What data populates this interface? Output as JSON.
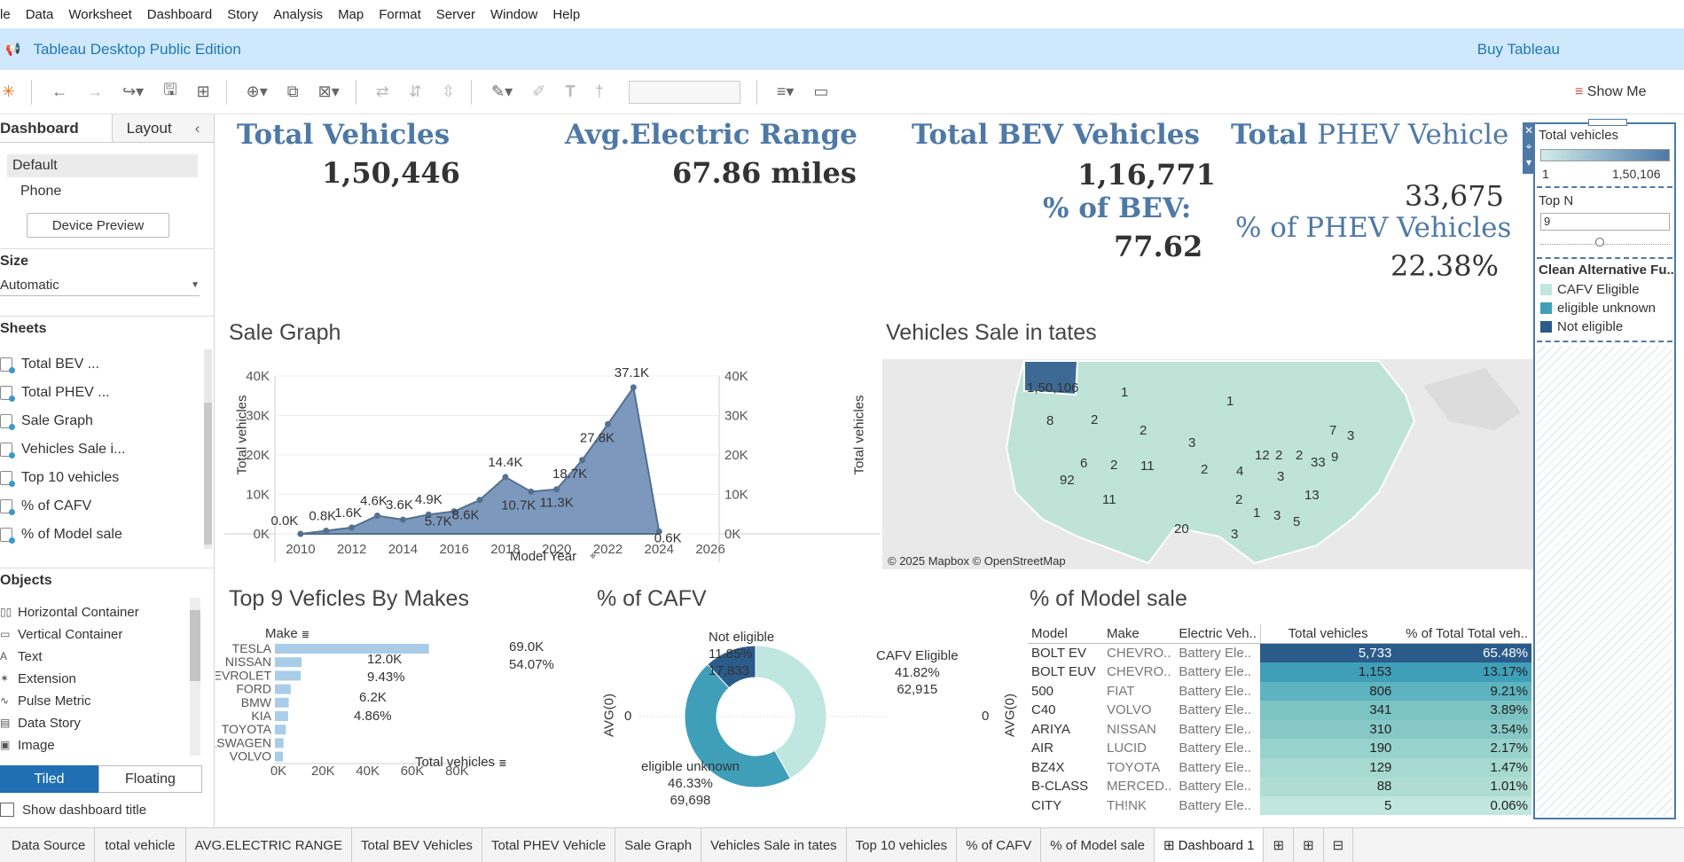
{
  "menu": [
    "le",
    "Data",
    "Worksheet",
    "Dashboard",
    "Story",
    "Analysis",
    "Map",
    "Format",
    "Server",
    "Window",
    "Help"
  ],
  "banner": {
    "title": "Tableau Desktop Public Edition",
    "buy": "Buy Tableau"
  },
  "toolbar": {
    "show_me": "Show Me"
  },
  "left": {
    "tab_dashboard": "Dashboard",
    "tab_layout": "Layout",
    "device_default": "Default",
    "device_phone": "Phone",
    "device_preview": "Device Preview",
    "size_label": "Size",
    "size_value": "Automatic",
    "sheets_label": "Sheets",
    "sheets": [
      "Total BEV ...",
      "Total PHEV ...",
      "Sale Graph",
      "Vehicles Sale i...",
      "Top 10 vehicles",
      "% of  CAFV",
      "% of Model sale"
    ],
    "objects_label": "Objects",
    "objects": [
      "Horizontal Container",
      "Vertical Container",
      "Text",
      "Extension",
      "Pulse Metric",
      "Data Story",
      "Image"
    ],
    "tiled": "Tiled",
    "floating": "Floating",
    "show_title": "Show dashboard title"
  },
  "kpi": {
    "total_vehicles_t": "Total Vehicles",
    "total_vehicles_v": "1,50,446",
    "avg_range_t": "Avg.Electric Range",
    "avg_range_v": "67.86 miles",
    "bev_t": "Total BEV Vehicles",
    "bev_v": "1,16,771",
    "bev_pct_t": "% of BEV:",
    "bev_pct_v": "77.62",
    "phev_t1": "Total",
    "phev_t2": "PHEV Vehicle",
    "phev_v": "33,675",
    "phev_pct_t": "% of PHEV Vehicles",
    "phev_pct_v": "22.38%"
  },
  "sale_graph": {
    "title": "Sale Graph",
    "xlabel": "Model Year",
    "ylabel": "Total vehicles"
  },
  "map": {
    "title": "Vehicles Sale in tates",
    "credit": "© 2025 Mapbox © OpenStreetMap",
    "labels": [
      "1,50,106",
      "1",
      "1",
      "2",
      "8",
      "2",
      "6",
      "2",
      "3",
      "11",
      "2",
      "4",
      "12",
      "2",
      "2",
      "3",
      "33",
      "9",
      "7",
      "3",
      "92",
      "11",
      "20",
      "13",
      "2",
      "1",
      "3",
      "5",
      "3"
    ]
  },
  "top_makes": {
    "title": "Top 9  Veficles By Makes",
    "header": "Make",
    "xlabel": "Total vehicles"
  },
  "cafv": {
    "title": "% of  CAFV",
    "axis": "AVG(0)",
    "zero": "0",
    "not_eligible": [
      "Not eligible",
      "11.85%",
      "17,833"
    ],
    "eligible": [
      "CAFV Eligible",
      "41.82%",
      "62,915"
    ],
    "unknown": [
      "eligible unknown",
      "46.33%",
      "69,698"
    ]
  },
  "model_sale": {
    "title": "% of Model sale",
    "headers": [
      "Model",
      "Make",
      "Electric Veh..",
      "Total vehicles",
      "% of Total Total veh.."
    ],
    "rows": [
      [
        "BOLT EV",
        "CHEVRO..",
        "Battery Ele..",
        "5,733",
        "65.48%"
      ],
      [
        "BOLT EUV",
        "CHEVRO..",
        "Battery Ele..",
        "1,153",
        "13.17%"
      ],
      [
        "500",
        "FIAT",
        "Battery Ele..",
        "806",
        "9.21%"
      ],
      [
        "C40",
        "VOLVO",
        "Battery Ele..",
        "341",
        "3.89%"
      ],
      [
        "ARIYA",
        "NISSAN",
        "Battery Ele..",
        "310",
        "3.54%"
      ],
      [
        "AIR",
        "LUCID",
        "Battery Ele..",
        "190",
        "2.17%"
      ],
      [
        "BZ4X",
        "TOYOTA",
        "Battery Ele..",
        "129",
        "1.47%"
      ],
      [
        "B-CLASS",
        "MERCED..",
        "Battery Ele..",
        "88",
        "1.01%"
      ],
      [
        "CITY",
        "TH!NK",
        "Battery Ele..",
        "5",
        "0.06%"
      ]
    ]
  },
  "right": {
    "legend_title": "Total vehicles",
    "legend_min": "1",
    "legend_max": "1,50,106",
    "topn_label": "Top N",
    "topn_value": "9",
    "clean_title": "Clean Alternative Fu..",
    "clean_items": [
      "CAFV Eligible",
      "eligible unknown",
      "Not eligible"
    ]
  },
  "tabs": [
    "Data Source",
    "total vehicle",
    "AVG.ELECTRIC RANGE",
    "Total BEV Vehicles",
    "Total PHEV Vehicle",
    "Sale Graph",
    "Vehicles Sale in tates",
    "Top 10 vehicles",
    "% of  CAFV",
    "% of Model sale",
    "Dashboard 1"
  ],
  "colors": {
    "accent": "#4e79a7",
    "banner": "#cfe8fb",
    "area": "#7d98bd",
    "cafv_eligible": "#bfe6df",
    "unknown": "#409fb8",
    "not_eligible": "#2b5b8a",
    "bar": "#a9cde8"
  },
  "chart_data": [
    {
      "type": "area",
      "title": "Sale Graph",
      "xlabel": "Model Year",
      "ylabel": "Total vehicles",
      "xlim": [
        2009,
        2026
      ],
      "ylim": [
        0,
        40000
      ],
      "x_ticks": [
        2010,
        2012,
        2014,
        2016,
        2018,
        2020,
        2022,
        2024,
        2026
      ],
      "y_ticks": [
        "0K",
        "10K",
        "20K",
        "30K",
        "40K"
      ],
      "x": [
        2010,
        2011,
        2012,
        2013,
        2014,
        2015,
        2016,
        2017,
        2018,
        2019,
        2020,
        2021,
        2022,
        2023,
        2024
      ],
      "values": [
        0,
        800,
        1600,
        4600,
        3600,
        4900,
        5700,
        8600,
        14400,
        10700,
        11300,
        18700,
        27800,
        37100,
        600
      ],
      "labels": [
        "0.0K",
        "0.8K",
        "1.6K",
        "4.6K",
        "3.6K",
        "4.9K",
        "5.7K",
        "8.6K",
        "14.4K",
        "10.7K",
        "11.3K",
        "18.7K",
        "27.8K",
        "37.1K",
        "0.6K"
      ]
    },
    {
      "type": "bar",
      "title": "Top 9  Veficles By Makes",
      "xlabel": "Total vehicles",
      "xlim": [
        0,
        90000
      ],
      "x_ticks": [
        "0K",
        "20K",
        "40K",
        "60K",
        "80K"
      ],
      "categories": [
        "TESLA",
        "NISSAN",
        "CHEVROLET",
        "FORD",
        "BMW",
        "KIA",
        "TOYOTA",
        "VOLKSWAGEN",
        "VOLVO"
      ],
      "values": [
        69000,
        12000,
        11600,
        7100,
        6200,
        5900,
        4900,
        3900,
        3600
      ],
      "labels": [
        [
          "69.0K",
          "54.07%"
        ],
        [
          "12.0K"
        ],
        [
          "9.43%"
        ],
        [],
        [
          "6.2K"
        ],
        [],
        [
          "4.86%"
        ],
        [],
        []
      ]
    },
    {
      "type": "pie",
      "title": "% of  CAFV",
      "categories": [
        "CAFV Eligible",
        "eligible unknown",
        "Not eligible"
      ],
      "values": [
        62915,
        69698,
        17833
      ],
      "percents": [
        41.82,
        46.33,
        11.85
      ]
    }
  ]
}
